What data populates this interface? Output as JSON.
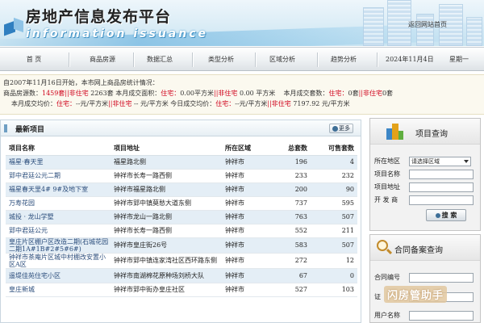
{
  "header": {
    "title": "房地产信息发布平台",
    "subtitle": "information issuance",
    "return_link": "返回网站首页"
  },
  "nav": {
    "items": [
      "首 页",
      "商品房源",
      "数据汇总",
      "类型分析",
      "区域分析",
      "趋势分析"
    ],
    "date": "2024年11月4日",
    "weekday": "星期一"
  },
  "stats": {
    "intro": "自2007年11月16日开始，本市网上商品房统计情况：",
    "row1": {
      "label1": "商品房源数：",
      "v1": "1459套",
      "sep1": "||",
      "label2": "非住宅",
      "v2": "2263套",
      "label3": " 本月成交面积：",
      "label4": "住宅：",
      "v4": "0.00平方米",
      "sep2": "||",
      "label5": "非住宅",
      "v5": "0.00 平方米",
      "label6": "本月成交套数：",
      "label7": "住宅：",
      "v7": "0套",
      "sep3": "||",
      "label8": "非住宅",
      "v8": "0套"
    },
    "row2": {
      "label1": "本月成交均价：",
      "label2": "住宅：",
      "v2": "--元/平方米",
      "sep1": "||",
      "label3": "非住宅",
      "v3": "-- 元/平方米",
      "label4": "今日成交均价：",
      "label5": "住宅：",
      "v5": "--元/平方米",
      "sep2": "||",
      "label6": "非住宅",
      "v6": "7197.92 元/平方米"
    }
  },
  "latest": {
    "title": "最新项目",
    "more": "更多",
    "columns": [
      "项目名称",
      "项目地址",
      "所在区域",
      "总套数",
      "可售套数"
    ],
    "rows": [
      [
        "福星·春天里",
        "福星路北侧",
        "钟祥市",
        "196",
        "4"
      ],
      [
        "郢中君廷公元二期",
        "钟祥市长寿一路西侧",
        "钟祥市",
        "233",
        "232"
      ],
      [
        "福星春天里4# 9#及地下室",
        "钟祥市福星路北侧",
        "钟祥市",
        "200",
        "90"
      ],
      [
        "万寿花园",
        "钟祥市郢中镇莫愁大道东侧",
        "钟祥市",
        "737",
        "595"
      ],
      [
        "城投 · 龙山学墅",
        "钟祥市龙山一路北侧",
        "钟祥市",
        "763",
        "507"
      ],
      [
        "郢中君廷公元",
        "钟祥市长寿一路西侧",
        "钟祥市",
        "552",
        "211"
      ],
      [
        "皇庄片区棚户区改造二期(石城花园二期1A#1B#2#5#6#)",
        "钟祥市皇庄街26号",
        "钟祥市",
        "583",
        "507"
      ],
      [
        "钟祥市茶庵片区城中村棚改安置小区A区",
        "钟祥市郢中镇连家湾社区西环路东侧",
        "钟祥市",
        "272",
        "12"
      ],
      [
        "遥堤佳苑住宅小区",
        "钟祥市南湖棉花原种场刘桥大队",
        "钟祥市",
        "67",
        "0"
      ],
      [
        "皇庄新城",
        "钟祥市郢中街办皇庄社区",
        "钟祥市",
        "527",
        "103"
      ]
    ]
  },
  "project_search": {
    "title": "项目查询",
    "area_label": "所在地区",
    "area_selected": "请选择区域",
    "name_label": "项目名称",
    "address_label": "项目地址",
    "developer_label": "开 发 商",
    "search_button": "搜 索"
  },
  "contract_search": {
    "title": "合同备案查询",
    "contract_no_label": "合同编号",
    "cert_label": "证",
    "username_label": "用户名称"
  },
  "watermark": "闪房管助手"
}
